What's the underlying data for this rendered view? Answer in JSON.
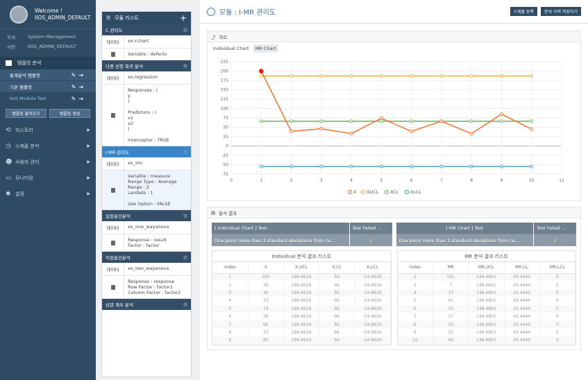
{
  "sidebar": {
    "welcome": "Welcome !",
    "user": "IIOS_ADMIN_DEFAULT",
    "dept_label": "부서",
    "dept": "System Management",
    "id_label": "사번",
    "id": "IIOS_ADMIN_DEFAULT",
    "menu_header": "템플릿 분석",
    "sub1": "통계분석 템플릿",
    "sub2": "기본 템플릿",
    "sub3": "IIoS Module Test",
    "btn_load": "템플릿 불러오기",
    "btn_save": "템플릿 생성",
    "nav": [
      "히스토리",
      "스케줄 분석",
      "사용자 관리",
      "모니터링",
      "설정"
    ]
  },
  "middle": {
    "header": "모듈 리스트",
    "groups": [
      {
        "title": "C 관리도",
        "rows": [
          {
            "k": "데이터",
            "v": "ex.cchart"
          },
          {
            "k": "lock",
            "v": "Variable : defects"
          }
        ]
      },
      {
        "title": "다중 선형 회귀 분석",
        "rows": [
          {
            "k": "데이터",
            "v": "ex.regression"
          },
          {
            "k": "lock",
            "v": "Responses : (\n    y\n)\n\nPredictors : (\n    x1\n    x2\n)\n\nInterceptor : TRUE"
          }
        ]
      },
      {
        "title": "I-MR 관리도",
        "rows": [
          {
            "k": "데이터",
            "v": "ex_imr"
          },
          {
            "k": "lock",
            "v": "Variable : measure\nRange Type : Average\nRange : 2\nLambda : 1\n\nUse Option : FALSE"
          }
        ]
      },
      {
        "title": "일원분산분석",
        "rows": [
          {
            "k": "데이터",
            "v": "ex_one_wayanova"
          },
          {
            "k": "lock",
            "v": "Response : result\nFactor : factor"
          }
        ]
      },
      {
        "title": "이원분산분석",
        "rows": [
          {
            "k": "데이터",
            "v": "ex_two_wayanova"
          },
          {
            "k": "lock",
            "v": "Response : response\nRow Factor : factor1\nColumn Factor : factor2"
          }
        ]
      },
      {
        "title": "상관 계수 분석",
        "rows": []
      }
    ]
  },
  "main": {
    "title": "모듈 : I-MR 관리도",
    "btn_schedule": "스케줄 등록",
    "btn_save": "분석 이력 저장하기",
    "chart_section": "차트",
    "tab1": "Individual Chart",
    "tab2": "MR Chart",
    "result_section": "분석 결과"
  },
  "chart_data": {
    "type": "line",
    "x": [
      1,
      2,
      3,
      4,
      5,
      6,
      7,
      8,
      9,
      10
    ],
    "xlim": [
      0,
      11
    ],
    "ylim": [
      -75,
      225
    ],
    "yticks": [
      225,
      200,
      175,
      150,
      125,
      100,
      75,
      50,
      25,
      0,
      -25,
      -50,
      -75
    ],
    "series": [
      {
        "name": "X",
        "color": "#f07a3a",
        "values": [
          200,
          39,
          46,
          33,
          74,
          39,
          66,
          33,
          85,
          45
        ]
      },
      {
        "name": "XUCL",
        "color": "#f0b43a",
        "values": [
          186.8629,
          186.8629,
          186.8629,
          186.8629,
          186.8629,
          186.8629,
          186.8629,
          186.8629,
          186.8629,
          186.8629
        ]
      },
      {
        "name": "XCL",
        "color": "#6abf5a",
        "values": [
          66,
          66,
          66,
          66,
          66,
          66,
          66,
          66,
          66,
          66
        ]
      },
      {
        "name": "XLCL",
        "color": "#4aa3c8",
        "values": [
          -54.8629,
          -54.8629,
          -54.8629,
          -54.8629,
          -54.8629,
          -54.8629,
          -54.8629,
          -54.8629,
          -54.8629,
          -54.8629
        ]
      }
    ]
  },
  "tests": {
    "ind_title": "[ Individual Chart ] Test",
    "ind_failed_h": "Test Failed ...",
    "ind_msg": "One point more than 3 standard deviations from ce...",
    "ind_failed": "1",
    "mr_title": "[ MR Chart ] Test",
    "mr_failed_h": "Test Failed ...",
    "mr_msg": "One point more than 3 standard deviations from ce...",
    "mr_failed": "2"
  },
  "ind_table": {
    "caption": "Individual 분석 결과 리스트",
    "cols": [
      "Index",
      "X",
      "X,UCL",
      "X,CL",
      "X,LCL"
    ],
    "rows": [
      [
        "1",
        "200",
        "186.8629",
        "66",
        "-54.8629"
      ],
      [
        "2",
        "39",
        "186.8629",
        "66",
        "-54.8629"
      ],
      [
        "3",
        "46",
        "186.8629",
        "66",
        "-54.8629"
      ],
      [
        "4",
        "33",
        "186.8629",
        "66",
        "-54.8629"
      ],
      [
        "5",
        "74",
        "186.8629",
        "66",
        "-54.8629"
      ],
      [
        "6",
        "39",
        "186.8629",
        "66",
        "-54.8629"
      ],
      [
        "7",
        "66",
        "186.8629",
        "66",
        "-54.8629"
      ],
      [
        "8",
        "33",
        "186.8629",
        "66",
        "-54.8629"
      ],
      [
        "9",
        "85",
        "186.8629",
        "66",
        "-54.8629"
      ]
    ]
  },
  "mr_table": {
    "caption": "MR 분석 결과 리스트",
    "cols": [
      "Index",
      "MR",
      "MR,UCL",
      "MR,CL",
      "MR,LCL"
    ],
    "rows": [
      [
        "2",
        "161",
        "148.4801",
        "45.4444",
        "0"
      ],
      [
        "3",
        "7",
        "148.4801",
        "45.4444",
        "0"
      ],
      [
        "4",
        "13",
        "148.4801",
        "45.4444",
        "0"
      ],
      [
        "5",
        "41",
        "148.4801",
        "45.4444",
        "0"
      ],
      [
        "6",
        "35",
        "148.4801",
        "45.4444",
        "0"
      ],
      [
        "7",
        "27",
        "148.4801",
        "45.4444",
        "0"
      ],
      [
        "8",
        "33",
        "148.4801",
        "45.4444",
        "0"
      ],
      [
        "9",
        "52",
        "148.4801",
        "45.4444",
        "0"
      ],
      [
        "10",
        "40",
        "148.4801",
        "45.4444",
        "0"
      ]
    ]
  }
}
